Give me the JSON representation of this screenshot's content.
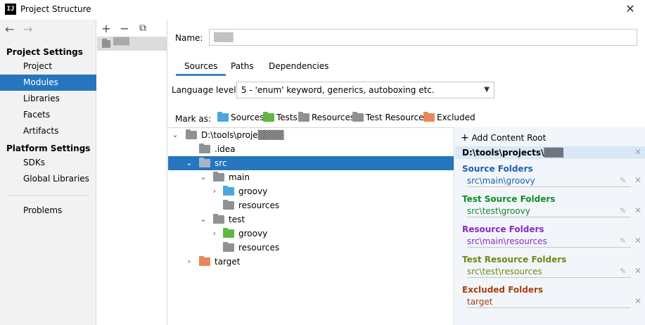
{
  "window": {
    "title": "Project Structure",
    "app_icon": "IJ"
  },
  "nav": {
    "back": "←",
    "forward": "→",
    "project_settings": "Project Settings",
    "platform_settings": "Platform Settings",
    "items": [
      "Project",
      "Modules",
      "Libraries",
      "Facets",
      "Artifacts"
    ],
    "platform_items": [
      "SDKs",
      "Global Libraries"
    ],
    "problems": "Problems"
  },
  "modules": {
    "add": "+",
    "remove": "−",
    "copy": "⧉",
    "selected": "▒▒▒"
  },
  "name": {
    "label": "Name:",
    "value": "▒▒▒"
  },
  "tabs": [
    "Sources",
    "Paths",
    "Dependencies"
  ],
  "language": {
    "label": "Language level:",
    "value": "5 - 'enum' keyword, generics, autoboxing etc."
  },
  "mark_as": {
    "label": "Mark as:",
    "items": [
      "Sources",
      "Tests",
      "Resources",
      "Test Resources",
      "Excluded"
    ]
  },
  "tree": {
    "root": "D:\\tools\\proje▒▒▒▒",
    "idea": ".idea",
    "src": "src",
    "main": "main",
    "groovy_main": "groovy",
    "resources_main": "resources",
    "test": "test",
    "groovy_test": "groovy",
    "resources_test": "resources",
    "target": "target"
  },
  "roots": {
    "add_label": "Add Content Root",
    "root_path": "D:\\tools\\projects\\▒▒▒",
    "groups": [
      {
        "title": "Source Folders",
        "path": "src\\main\\groovy",
        "color": "#1e60b0"
      },
      {
        "title": "Test Source Folders",
        "path": "src\\test\\groovy",
        "color": "#0c8c2a"
      },
      {
        "title": "Resource Folders",
        "path": "src\\main\\resources",
        "color": "#8a2ac0"
      },
      {
        "title": "Test Resource Folders",
        "path": "src\\test\\resources",
        "color": "#6c8a13"
      },
      {
        "title": "Excluded Folders",
        "path": "target",
        "color": "#a83f10"
      }
    ]
  }
}
